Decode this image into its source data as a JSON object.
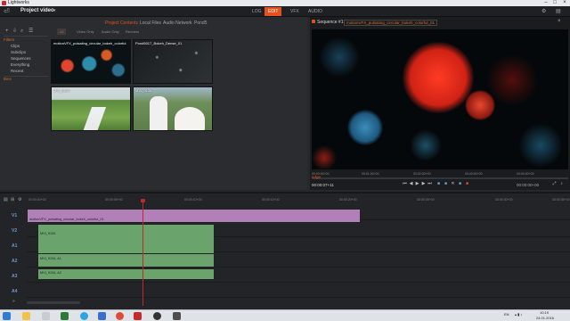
{
  "window": {
    "title": "Lightworks"
  },
  "appbar": {
    "project_title": "Project video",
    "mode_tabs": [
      {
        "label": "LOG",
        "active": false
      },
      {
        "label": "EDIT",
        "active": true
      },
      {
        "label": "VFX",
        "active": false
      },
      {
        "label": "AUDIO",
        "active": false
      }
    ]
  },
  "browser": {
    "tabs": [
      {
        "label": "Project Contents",
        "active": true
      },
      {
        "label": "Local Files",
        "active": false
      },
      {
        "label": "Audio Network",
        "active": false
      },
      {
        "label": "Pond5",
        "active": false
      }
    ],
    "filter_tabs": [
      {
        "label": "All",
        "active": true
      },
      {
        "label": "Video Only",
        "active": false
      },
      {
        "label": "Audio Only",
        "active": false
      },
      {
        "label": "Renders",
        "active": false
      }
    ],
    "tree": {
      "filters_label": "Filters",
      "items": [
        "Clips",
        "Subclips",
        "Sequences",
        "Everything",
        "Recent"
      ],
      "bins_label": "Bins"
    },
    "clips": [
      {
        "label": "motionVFX_pulsating_circular_bokeh_colorful"
      },
      {
        "label": "Pond5017_Bokeh_Dense_01"
      },
      {
        "label": "MVI_9134"
      },
      {
        "label": "MVI_9136"
      }
    ]
  },
  "viewer": {
    "sequence_title": "Sequence #1",
    "clip_name": "motionVFX_pulsating_circular_bokeh_colorful_01",
    "ruler": [
      "00:00:00+00",
      "00:01:00+00",
      "00:02:00+00",
      "00:03:00+00",
      "00:04:00+00"
    ],
    "in_label": "edge",
    "timecode": "00:00:07+11",
    "clip_timecode": "00:00:00+00"
  },
  "timeline": {
    "ticks": [
      "00:00:00+00",
      "00:00:05+00",
      "00:00:10+00",
      "00:00:15+00",
      "00:00:20+00",
      "00:00:25+00",
      "00:00:30+00",
      "00:00:35+00"
    ],
    "tracks": [
      {
        "label": "V1",
        "clip": "motionVFX_pulsating_circular_bokeh_colorful_01"
      },
      {
        "label": "V2",
        "clip": "MVI_9134"
      },
      {
        "label": "A1",
        "clip": "MVI_9134, A1"
      },
      {
        "label": "A2",
        "clip": "MVI_9134, A2"
      },
      {
        "label": "A3",
        "clip": ""
      },
      {
        "label": "A4",
        "clip": ""
      }
    ]
  },
  "taskbar": {
    "lang": "EN",
    "time": "10:19",
    "date": "24.01.2016"
  },
  "colors": {
    "accent": "#e2521f",
    "video_clip": "#b180b8",
    "audio_clip": "#6aa36c",
    "playhead": "#c0282a"
  }
}
